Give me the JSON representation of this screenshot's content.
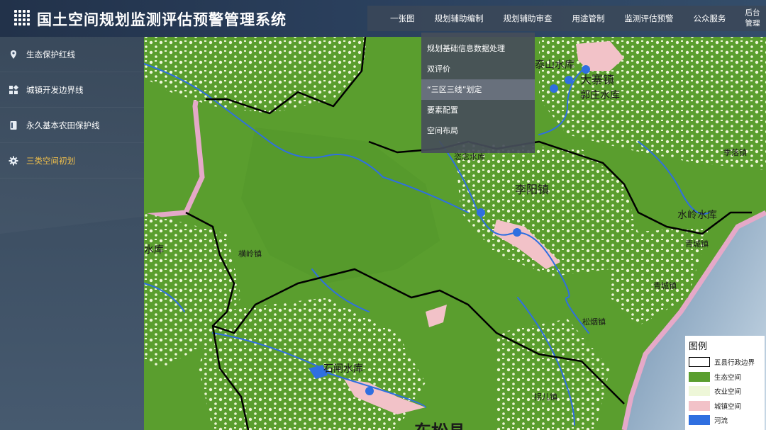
{
  "header": {
    "title": "国土空间规划监测评估预警管理系统",
    "nav": [
      {
        "label": "一张图"
      },
      {
        "label": "规划辅助编制"
      },
      {
        "label": "规划辅助审查"
      },
      {
        "label": "用途管制"
      },
      {
        "label": "监测评估预警"
      },
      {
        "label": "公众服务"
      }
    ],
    "admin_line1": "后台",
    "admin_line2": "管理"
  },
  "dropdown": {
    "items": [
      {
        "label": "规划基础信息数据处理"
      },
      {
        "label": "双评价"
      },
      {
        "label": "“三区三线”划定"
      },
      {
        "label": "要素配置"
      },
      {
        "label": "空间布局"
      }
    ]
  },
  "sidebar": {
    "items": [
      {
        "label": "生态保护红线",
        "icon": "location-pin-icon"
      },
      {
        "label": "城镇开发边界线",
        "icon": "grid-blocks-icon"
      },
      {
        "label": "永久基本农田保护线",
        "icon": "document-icon"
      },
      {
        "label": "三类空间初划",
        "icon": "gear-icon"
      }
    ],
    "active_color": "#f3c14b"
  },
  "map": {
    "labels": [
      "泰山水库",
      "大寨镇",
      "郭庄水库",
      "恣念水库",
      "李阳镇",
      "季落镇",
      "水岭水库",
      "青城镇",
      "青城镇",
      "水库",
      "横岭镇",
      "松烟镇",
      "石闸水库",
      "拐儿镇",
      "东松县"
    ]
  },
  "legend": {
    "title": "图例",
    "items": [
      {
        "label": "五县行政边界",
        "color": "#ffffff"
      },
      {
        "label": "生态空间",
        "color": "#5a9e2e"
      },
      {
        "label": "农业空间",
        "color": "#eef7d8"
      },
      {
        "label": "城镇空间",
        "color": "#f2c2c8"
      },
      {
        "label": "河流",
        "color": "#2f6fe0"
      }
    ]
  }
}
